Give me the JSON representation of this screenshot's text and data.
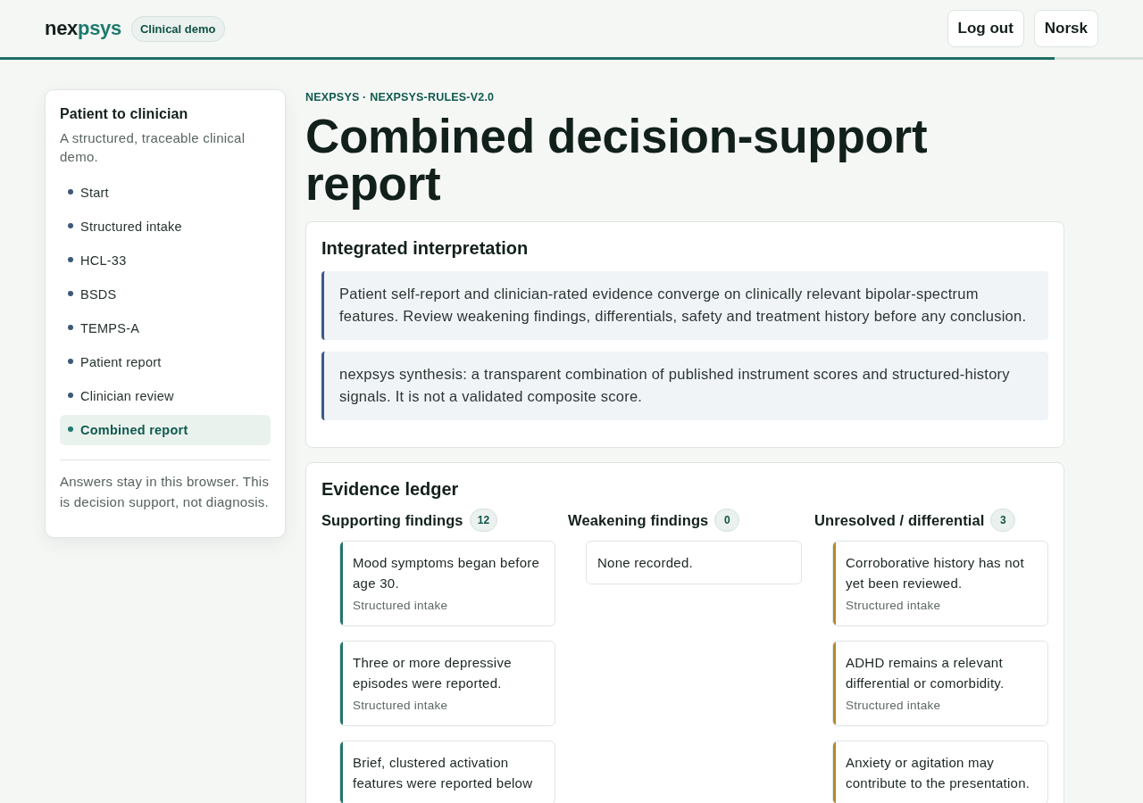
{
  "header": {
    "logo": [
      {
        "text": "nex",
        "accent": false
      },
      {
        "text": "psys",
        "accent": true
      }
    ],
    "badge": "Clinical demo",
    "buttons": [
      "Log out",
      "Norsk"
    ]
  },
  "progress": {
    "level": 0.923
  },
  "sidebar": {
    "title": "Patient to clinician",
    "subtitle": "A structured, traceable clinical demo.",
    "items": [
      {
        "label": "Start",
        "selected": false
      },
      {
        "label": "Structured intake",
        "selected": false
      },
      {
        "label": "HCL-33",
        "selected": false
      },
      {
        "label": "BSDS",
        "selected": false
      },
      {
        "label": "TEMPS-A",
        "selected": false
      },
      {
        "label": "Patient report",
        "selected": false
      },
      {
        "label": "Clinician review",
        "selected": false
      },
      {
        "label": "Combined report",
        "selected": true
      }
    ],
    "footer": "Answers stay in this browser. This is decision support, not diagnosis."
  },
  "main": {
    "eyebrow": "NEXPSYS · NEXPSYS-RULES-V2.0",
    "title": "Combined decision-support report",
    "interpretation": {
      "heading": "Integrated interpretation",
      "notes": [
        "Patient self-report and clinician-rated evidence converge on clinically relevant bipolar-spectrum features. Review weakening findings, differentials, safety and treatment history before any conclusion.",
        "nexpsys synthesis: a transparent combination of published instrument scores and structured-history signals. It is not a validated composite score."
      ]
    },
    "ledger": {
      "heading": "Evidence ledger",
      "columns": [
        {
          "title": "Supporting findings",
          "count": "12",
          "color": "#22756b",
          "findings": [
            {
              "text": "Mood symptoms began before age 30.",
              "source": "Structured intake"
            },
            {
              "text": "Three or more depressive episodes were reported.",
              "source": "Structured intake"
            },
            {
              "text": "Brief, clustered activation features were reported below"
            }
          ]
        },
        {
          "title": "Weakening findings",
          "count": "0",
          "empty_text": "None recorded."
        },
        {
          "title": "Unresolved / differential",
          "count": "3",
          "color": "#b8862f",
          "findings": [
            {
              "text": "Corroborative history has not yet been reviewed.",
              "source": "Structured intake"
            },
            {
              "text": "ADHD remains a relevant differential or comorbidity.",
              "source": "Structured intake"
            },
            {
              "text": "Anxiety or agitation may contribute to the presentation."
            }
          ]
        }
      ]
    }
  }
}
